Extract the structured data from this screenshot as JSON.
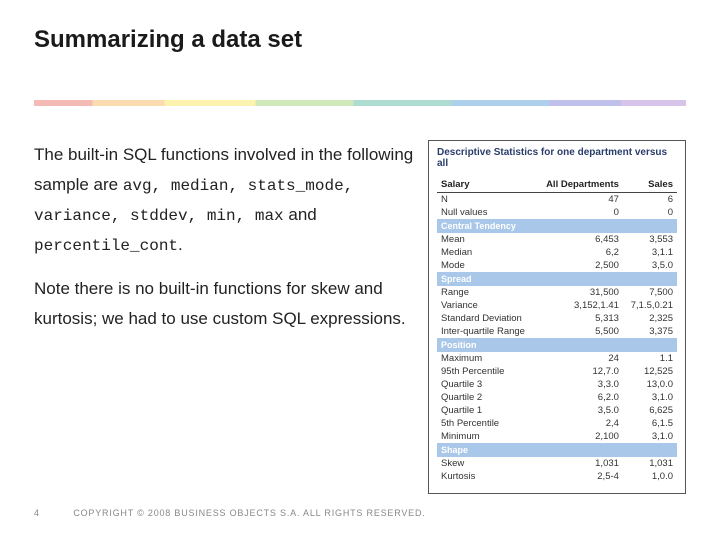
{
  "title": "Summarizing a data set",
  "body": {
    "p1_a": "The built-in SQL functions involved in the following sample are ",
    "fns": "avg, median, stats_mode, variance, stddev, min, max",
    "p1_b": " and ",
    "fn_last": "percentile_cont",
    "p1_c": ".",
    "p2": "Note there is no built-in functions for skew and kurtosis; we had to use custom SQL expressions."
  },
  "table": {
    "caption": "Descriptive Statistics for one department versus all",
    "head": {
      "c1": "Salary",
      "c2": "All Departments",
      "c3": "Sales"
    },
    "rows": {
      "n": {
        "label": "N",
        "all": "47",
        "sales": "6"
      },
      "null": {
        "label": "Null values",
        "all": "0",
        "sales": "0"
      }
    },
    "section_ct": "Central Tendency",
    "ct": {
      "mean": {
        "label": "Mean",
        "all": "6,453",
        "sales": "3,553"
      },
      "median": {
        "label": "Median",
        "all": "6,2",
        "sales": "3,1.1"
      },
      "mode": {
        "label": "Mode",
        "all": "2,500",
        "sales": "3,5.0"
      }
    },
    "section_sp": "Spread",
    "sp": {
      "range": {
        "label": "Range",
        "all": "31,500",
        "sales": "7,500"
      },
      "variance": {
        "label": "Variance",
        "all": "3,152,1.41",
        "sales": "7,1.5,0.21"
      },
      "stddev": {
        "label": "Standard Deviation",
        "all": "5,313",
        "sales": "2,325"
      },
      "iqr": {
        "label": "Inter-quartile Range",
        "all": "5,500",
        "sales": "3,375"
      }
    },
    "section_pos": "Position",
    "pos": {
      "max": {
        "label": "Maximum",
        "all": "24",
        "sales": "1.1"
      },
      "p95": {
        "label": "95th Percentile",
        "all": "12,7.0",
        "sales": "12,525"
      },
      "q3": {
        "label": "Quartile 3",
        "all": "3,3.0",
        "sales": "13,0.0"
      },
      "q2": {
        "label": "Quartile 2",
        "all": "6,2.0",
        "sales": "3,1.0"
      },
      "q1": {
        "label": "Quartile 1",
        "all": "3,5.0",
        "sales": "6,625"
      },
      "p5": {
        "label": "5th Percentile",
        "all": "2,4",
        "sales": "6,1.5"
      },
      "min": {
        "label": "Minimum",
        "all": "2,100",
        "sales": "3,1.0"
      }
    },
    "section_sh": "Shape",
    "sh": {
      "skew": {
        "label": "Skew",
        "all": "1,031",
        "sales": "1,031"
      },
      "kurt": {
        "label": "Kurtosis",
        "all": "2,5-4",
        "sales": "1,0.0"
      }
    }
  },
  "footer": {
    "page": "4",
    "copyright": "COPYRIGHT © 2008 BUSINESS OBJECTS S.A.  ALL RIGHTS RESERVED."
  }
}
